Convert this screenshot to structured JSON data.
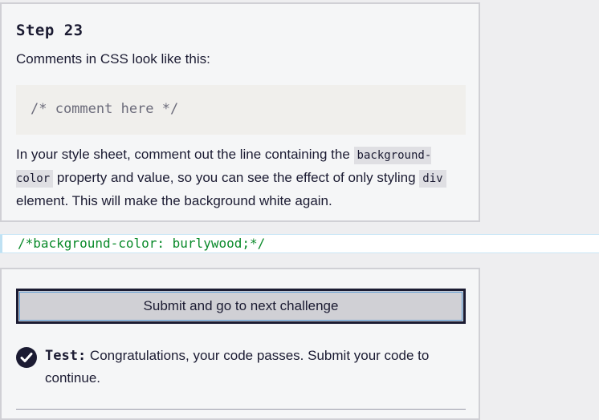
{
  "instructions": {
    "step_title": "Step 23",
    "intro": "Comments in CSS look like this:",
    "code_example": "/* comment here */",
    "body_part1": "In your style sheet, comment out the line containing the ",
    "inline_code1": "background-color",
    "body_part2": " property and value, so you can see the effect of only styling ",
    "inline_code2": "div",
    "body_part3": " element. This will make the background white again."
  },
  "editor": {
    "line_code": "/*background-color: burlywood;*/"
  },
  "test_panel": {
    "submit_label": "Submit and go to next challenge",
    "test_label": "Test:",
    "test_message": "Congratulations, your code passes. Submit your code to continue."
  },
  "icons": {
    "check": "check-circle-icon"
  },
  "colors": {
    "code_text": "#0a8a2a",
    "panel_bg": "#f5f6f7",
    "button_bg": "#d0d0d5"
  }
}
